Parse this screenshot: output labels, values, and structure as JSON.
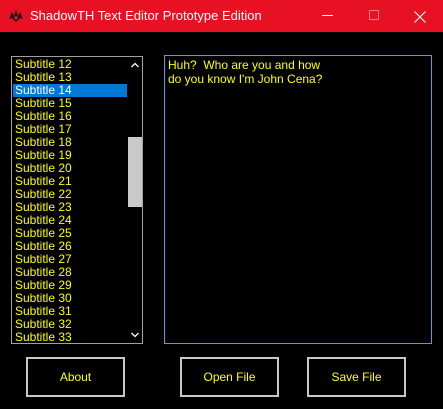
{
  "window": {
    "title": "ShadowTH Text Editor Prototype Edition",
    "titlebar_color": "#e81123"
  },
  "subtitle_list": {
    "items": [
      "Subtitle 12",
      "Subtitle 13",
      "Subtitle 14",
      "Subtitle 15",
      "Subtitle 16",
      "Subtitle 17",
      "Subtitle 18",
      "Subtitle 19",
      "Subtitle 20",
      "Subtitle 21",
      "Subtitle 22",
      "Subtitle 23",
      "Subtitle 24",
      "Subtitle 25",
      "Subtitle 26",
      "Subtitle 27",
      "Subtitle 28",
      "Subtitle 29",
      "Subtitle 30",
      "Subtitle 31",
      "Subtitle 32",
      "Subtitle 33"
    ],
    "selected_item": "Subtitle 14",
    "scroll_position": 0.35,
    "visible_fraction": 0.55
  },
  "editor": {
    "text": "Huh?  Who are you and how\ndo you know I'm John Cena?"
  },
  "buttons": {
    "about_label": "About",
    "open_label": "Open File",
    "save_label": "Save File"
  },
  "colors": {
    "background": "#000000",
    "text": "#ffff00",
    "selection": "#0078d7",
    "editor_border": "#4aa3df"
  }
}
